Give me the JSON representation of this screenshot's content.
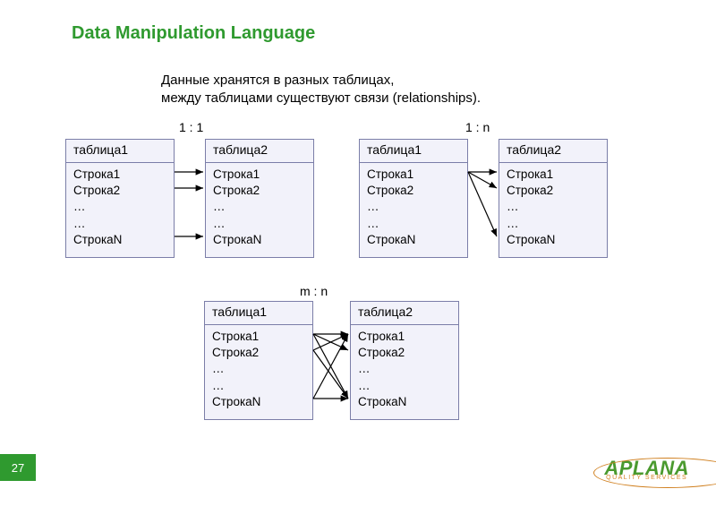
{
  "title": "Data Manipulation Language",
  "description_line1": "Данные хранятся в разных таблицах,",
  "description_line2": "между таблицами существуют связи (relationships).",
  "labels": {
    "one_to_one": "1 : 1",
    "one_to_many": "1 : n",
    "many_to_many": "m : n"
  },
  "table": {
    "header1": "таблица1",
    "header2": "таблица2",
    "row1": "Строка1",
    "row2": "Строка2",
    "dots": "…",
    "rowN": "СтрокаN"
  },
  "page_number": "27",
  "logo": {
    "main": "APLANA",
    "sub": "QUALITY SERVICES"
  }
}
